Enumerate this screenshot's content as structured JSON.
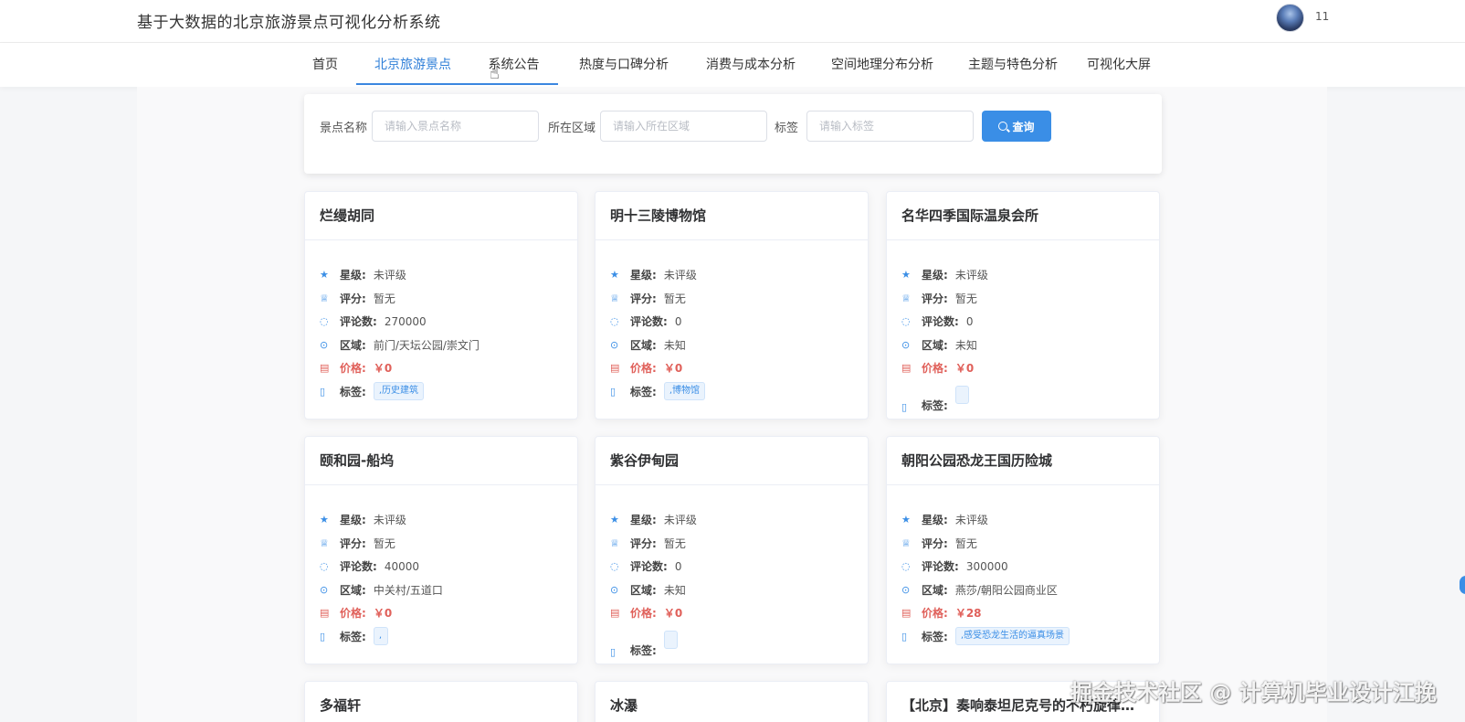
{
  "header": {
    "title": "基于大数据的北京旅游景点可视化分析系统",
    "user_name": "11"
  },
  "nav": {
    "items": [
      {
        "label": "首页"
      },
      {
        "label": "北京旅游景点"
      },
      {
        "label": "系统公告"
      },
      {
        "label": "热度与口碑分析"
      },
      {
        "label": "消费与成本分析"
      },
      {
        "label": "空间地理分布分析"
      },
      {
        "label": "主题与特色分析"
      },
      {
        "label": "可视化大屏"
      }
    ]
  },
  "search": {
    "name_label": "景点名称",
    "name_placeholder": "请输入景点名称",
    "area_label": "所在区域",
    "area_placeholder": "请输入所在区域",
    "tag_label": "标签",
    "tag_placeholder": "请输入标签",
    "button_label": "查询"
  },
  "field_labels": {
    "star": "星级:",
    "score": "评分:",
    "reviews": "评论数:",
    "area": "区域:",
    "price": "价格:",
    "tags": "标签:"
  },
  "cards": [
    {
      "title": "烂缦胡同",
      "star": "未评级",
      "score": "暂无",
      "reviews": "270000",
      "area": "前门/天坛公园/崇文门",
      "price": "￥0",
      "tag": ",历史建筑"
    },
    {
      "title": "明十三陵博物馆",
      "star": "未评级",
      "score": "暂无",
      "reviews": "0",
      "area": "未知",
      "price": "￥0",
      "tag": ",博物馆"
    },
    {
      "title": "名华四季国际温泉会所",
      "star": "未评级",
      "score": "暂无",
      "reviews": "0",
      "area": "未知",
      "price": "￥0",
      "tag": ""
    },
    {
      "title": "颐和园-船坞",
      "star": "未评级",
      "score": "暂无",
      "reviews": "40000",
      "area": "中关村/五道口",
      "price": "￥0",
      "tag": ","
    },
    {
      "title": "紫谷伊甸园",
      "star": "未评级",
      "score": "暂无",
      "reviews": "0",
      "area": "未知",
      "price": "￥0",
      "tag": ""
    },
    {
      "title": "朝阳公园恐龙王国历险城",
      "star": "未评级",
      "score": "暂无",
      "reviews": "300000",
      "area": "燕莎/朝阳公园商业区",
      "price": "￥28",
      "tag": ",感受恐龙生活的逼真场景"
    },
    {
      "title": "多福轩"
    },
    {
      "title": "冰瀑"
    },
    {
      "title": "【北京】奏响泰坦尼克号的不朽旋律…"
    }
  ],
  "watermark": "掘金技术社区 @ 计算机毕业设计江挽",
  "colors": {
    "accent": "#3a8ee6",
    "price": "#e0605a"
  }
}
